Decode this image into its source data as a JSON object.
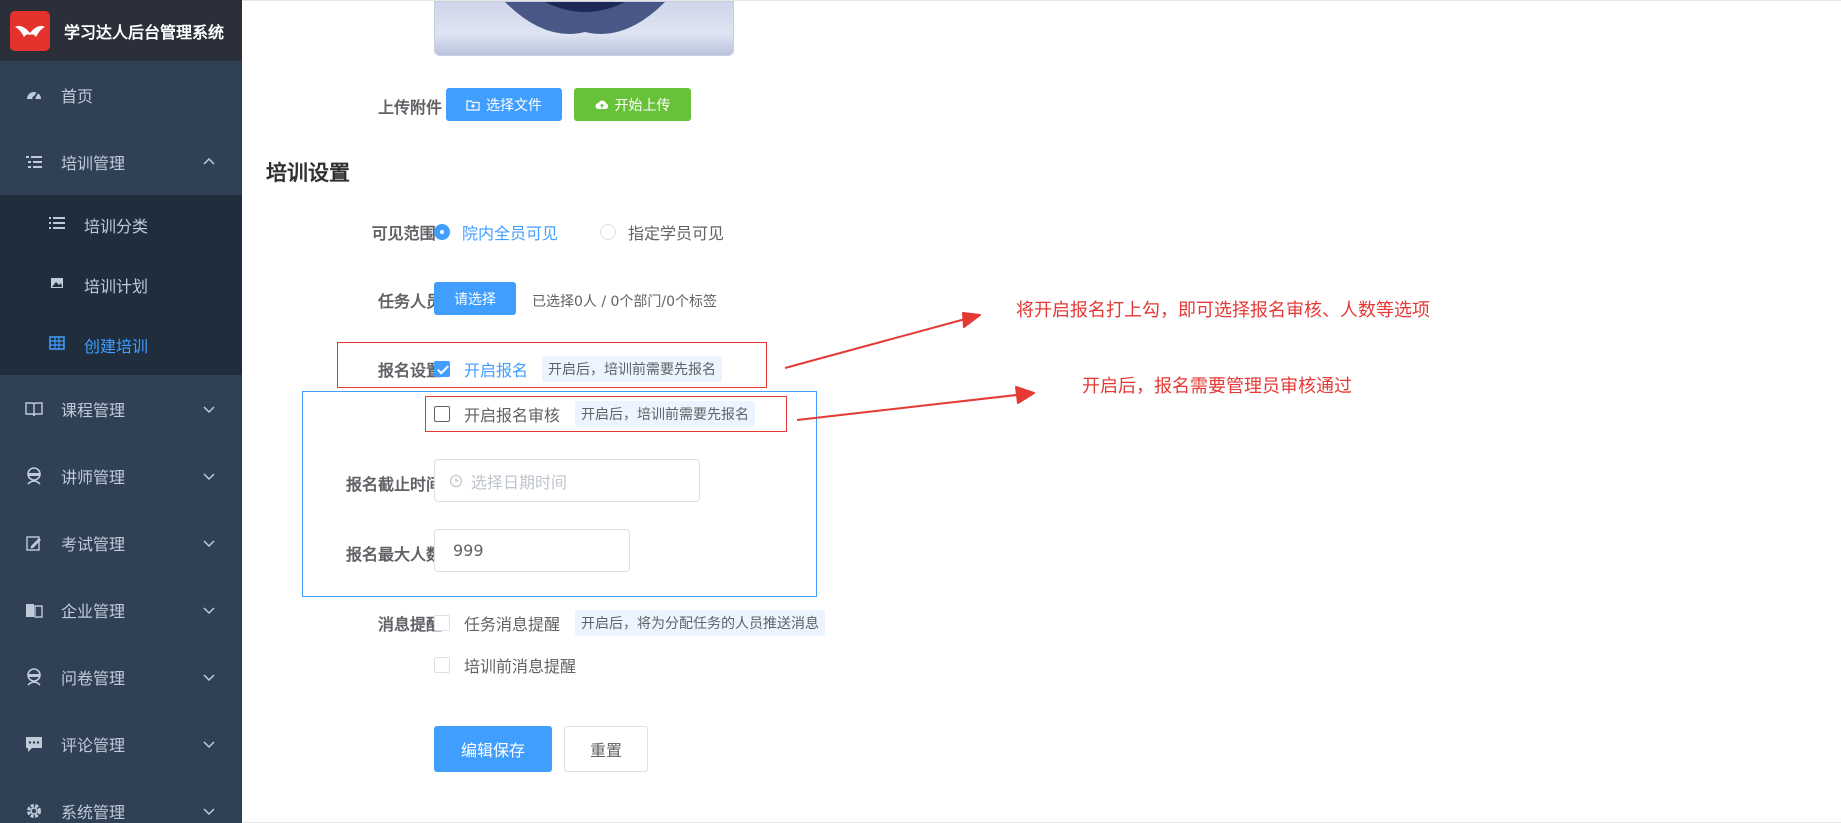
{
  "app": {
    "title": "学习达人后台管理系统"
  },
  "sidebar": {
    "items": [
      {
        "label": "首页",
        "icon": "dashboard-icon"
      },
      {
        "label": "培训管理",
        "icon": "list-icon",
        "expanded": true,
        "children": [
          {
            "label": "培训分类",
            "icon": "list-icon"
          },
          {
            "label": "培训计划",
            "icon": "image-icon"
          },
          {
            "label": "创建培训",
            "icon": "table-icon",
            "active": true
          }
        ]
      },
      {
        "label": "课程管理",
        "icon": "book-icon"
      },
      {
        "label": "讲师管理",
        "icon": "user-icon"
      },
      {
        "label": "考试管理",
        "icon": "edit-icon"
      },
      {
        "label": "企业管理",
        "icon": "building-icon"
      },
      {
        "label": "问卷管理",
        "icon": "survey-icon"
      },
      {
        "label": "评论管理",
        "icon": "comment-icon"
      },
      {
        "label": "系统管理",
        "icon": "gear-icon"
      }
    ]
  },
  "form": {
    "upload": {
      "label": "上传附件",
      "choose_button": "选择文件",
      "start_button": "开始上传"
    },
    "section_title": "培训设置",
    "visibility": {
      "label": "可见范围:",
      "options": [
        "院内全员可见",
        "指定学员可见"
      ],
      "selected": 0
    },
    "task_people": {
      "label": "任务人员",
      "button": "请选择",
      "selected_text": "已选择0人 / 0个部门/0个标签"
    },
    "registration": {
      "label": "报名设置",
      "enable": {
        "label": "开启报名",
        "hint": "开启后，培训前需要先报名",
        "checked": true
      },
      "review": {
        "label": "开启报名审核",
        "hint": "开启后，培训前需要先报名",
        "checked": false
      }
    },
    "deadline": {
      "label": "报名截止时间",
      "placeholder": "选择日期时间"
    },
    "max_people": {
      "label": "报名最大人数",
      "value": "999"
    },
    "message": {
      "label": "消息提醒",
      "task": {
        "label": "任务消息提醒",
        "hint": "开启后，将为分配任务的人员推送消息"
      },
      "pre": {
        "label": "培训前消息提醒"
      }
    },
    "actions": {
      "save": "编辑保存",
      "reset": "重置"
    }
  },
  "annotations": {
    "note1": "将开启报名打上勾，即可选择报名审核、人数等选项",
    "note2": "开启后，报名需要管理员审核通过",
    "color": "#e53935"
  },
  "colors": {
    "primary": "#409eff",
    "success": "#67c23a",
    "sidebar": "#304156",
    "submenu": "#1f2d3d",
    "logo_red": "#e5322d"
  }
}
